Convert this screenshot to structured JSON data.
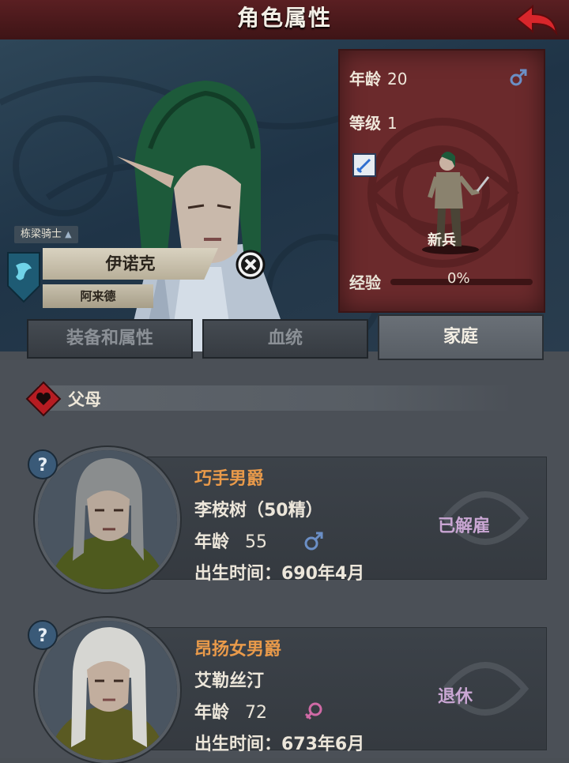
{
  "header": {
    "title": "角色属性"
  },
  "character": {
    "rank": "栋梁骑士",
    "name": "伊诺克",
    "house": "阿来德",
    "age_label": "年龄",
    "age": "20",
    "level_label": "等级",
    "level": "1",
    "class_name": "新兵",
    "exp_label": "经验",
    "exp_value": "0%",
    "exp_fraction": 0
  },
  "tabs": [
    {
      "label": "装备和属性",
      "active": false
    },
    {
      "label": "血统",
      "active": false
    },
    {
      "label": "家庭",
      "active": true
    }
  ],
  "family": {
    "section_label": "父母",
    "members": [
      {
        "title": "巧手男爵",
        "name": "李桉树（50精）",
        "age_label": "年龄",
        "age": "55",
        "gender": "male",
        "birth": "出生时间：690年4月",
        "status": "已解雇"
      },
      {
        "title": "昂扬女男爵",
        "name": "艾勒丝汀",
        "age_label": "年龄",
        "age": "72",
        "gender": "female",
        "birth": "出生时间：673年6月",
        "status": "退休"
      }
    ]
  },
  "colors": {
    "title_bar": "#4a1a1c",
    "stat_panel": "#6b2a2c",
    "card_title": "#e99a4a",
    "status_text": "#c9a6d3",
    "male": "#6b8fc6",
    "female": "#d06aa6"
  }
}
